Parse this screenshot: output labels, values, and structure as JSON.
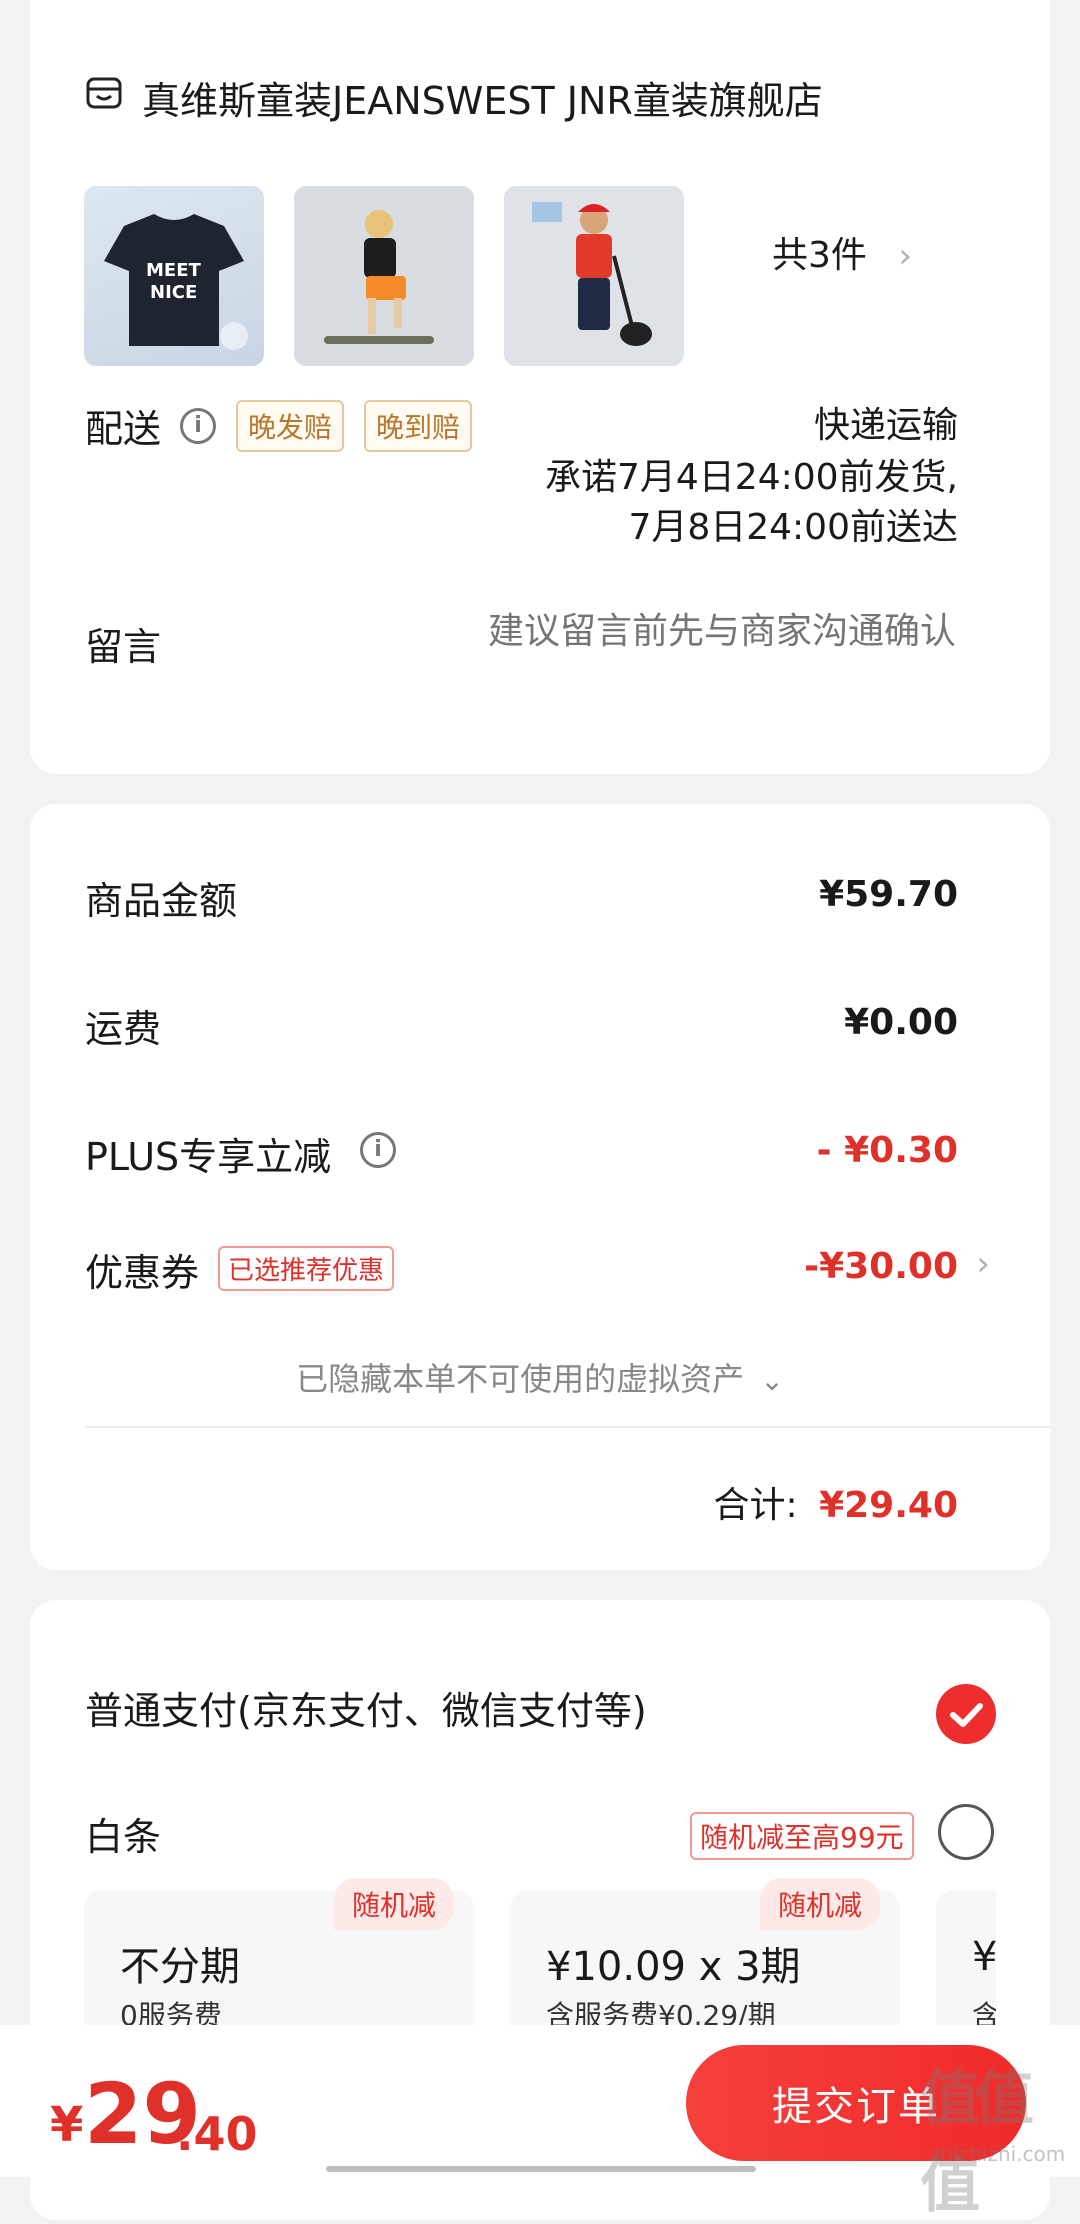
{
  "shop": {
    "name": "真维斯童装JEANSWEST JNR童装旗舰店",
    "item_count": "共3件",
    "delivery_label": "配送",
    "delivery_tags": [
      "晚发赔",
      "晚到赔"
    ],
    "delivery_method": "快递运输",
    "delivery_promise_1": "承诺7月4日24:00前发货,",
    "delivery_promise_2": "7月8日24:00前送达",
    "message_label": "留言",
    "message_placeholder": "建议留言前先与商家沟通确认"
  },
  "price": {
    "goods_label": "商品金额",
    "goods_amount": "¥59.70",
    "shipping_label": "运费",
    "shipping_amount": "¥0.00",
    "plus_label": "PLUS专享立减",
    "plus_amount": "- ¥0.30",
    "coupon_label": "优惠券",
    "coupon_tag": "已选推荐优惠",
    "coupon_amount": "-¥30.00",
    "hidden_assets": "已隐藏本单不可使用的虚拟资产",
    "total_label": "合计:",
    "total_amount": "¥29.40"
  },
  "payment": {
    "normal_label": "普通支付(京东支付、微信支付等)",
    "baitiao_label": "白条",
    "baitiao_promo": "随机减至高99元",
    "plans": [
      {
        "badge": "随机减",
        "title": "不分期",
        "sub": "0服务费"
      },
      {
        "badge": "随机减",
        "title": "¥10.09 x 3期",
        "sub": "含服务费¥0.29/期"
      },
      {
        "title": "¥",
        "sub": "含"
      }
    ]
  },
  "footer": {
    "yen": "¥",
    "total_int": "29",
    "total_dec": ".40",
    "submit_label": "提交订单"
  },
  "watermark": {
    "logo": "值值值",
    "site": "zhizhizhi.com"
  },
  "colors": {
    "accent_red": "#e0302a",
    "tag_gold": "#b8772a"
  }
}
